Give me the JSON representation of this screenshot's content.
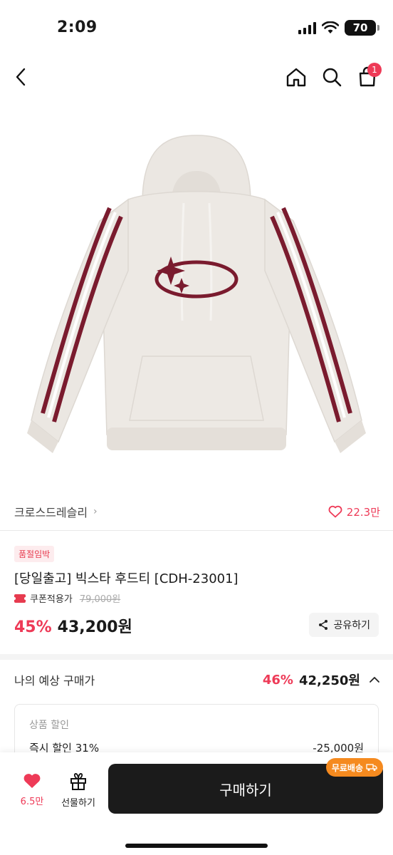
{
  "status_bar": {
    "time": "2:09",
    "battery": "70"
  },
  "nav": {
    "cart_count": "1"
  },
  "product": {
    "brand": "크로스드레슬리",
    "likes": "22.3만",
    "badge": "품절임박",
    "title": "[당일출고] 빅스타 후드티 [CDH-23001]",
    "coupon_label": "쿠폰적용가",
    "original_price": "79,000원",
    "discount_rate": "45%",
    "sale_price": "43,200원",
    "share_label": "공유하기"
  },
  "estimate": {
    "label": "나의 예상 구매가",
    "rate": "46%",
    "price": "42,250원",
    "discount_heading": "상품 할인",
    "discount_item": "즉시 할인 31%",
    "discount_amount": "-25,000원"
  },
  "bottom_bar": {
    "wish_count": "6.5만",
    "gift_label": "선물하기",
    "buy_label": "구매하기",
    "free_shipping": "무료배송"
  },
  "colors": {
    "accent": "#ee3a57",
    "buy_button": "#1b1b1b",
    "shipping_badge": "#f58a1f",
    "stripe": "#7a1b2e",
    "hoodie": "#ede9e4"
  }
}
